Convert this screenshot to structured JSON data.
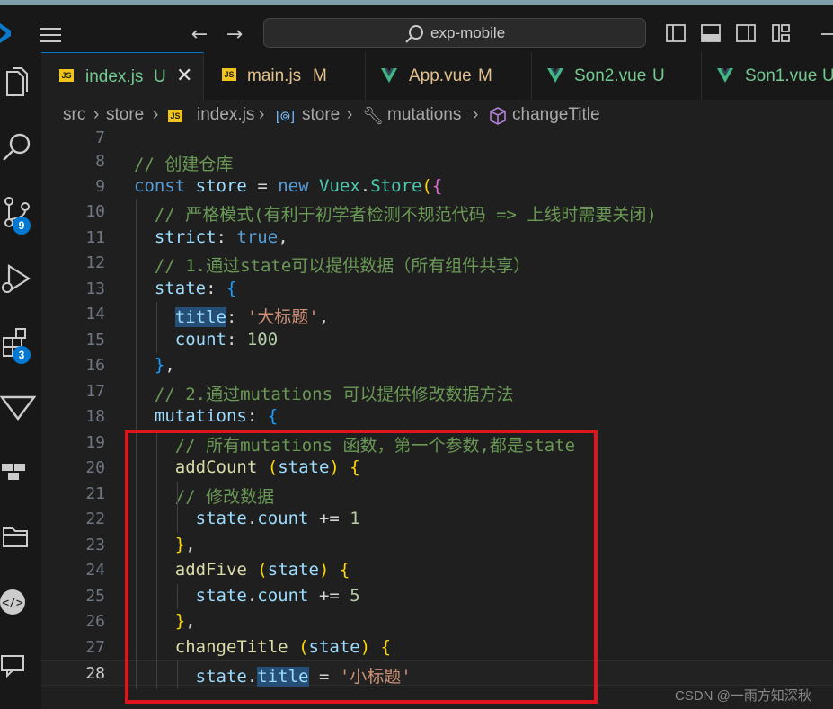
{
  "window": {
    "search_text": "exp-mobile"
  },
  "tabs": [
    {
      "name": "index.js",
      "status": "U",
      "icon": "js-icon",
      "active": true
    },
    {
      "name": "main.js",
      "status": "M",
      "icon": "js-icon",
      "active": false
    },
    {
      "name": "App.vue",
      "status": "M",
      "icon": "vue-icon",
      "active": false
    },
    {
      "name": "Son2.vue",
      "status": "U",
      "icon": "vue-icon",
      "active": false
    },
    {
      "name": "Son1.vue",
      "status": "U",
      "icon": "vue-icon",
      "active": false
    }
  ],
  "badges": {
    "source_control": "9",
    "extensions": "3"
  },
  "breadcrumb": [
    "src",
    "store",
    "index.js",
    "store",
    "mutations",
    "changeTitle"
  ],
  "editor": {
    "current_line": "28",
    "line_numbers": [
      "7",
      "8",
      "9",
      "10",
      "11",
      "12",
      "13",
      "14",
      "15",
      "16",
      "17",
      "18",
      "19",
      "20",
      "21",
      "22",
      "23",
      "24",
      "25",
      "26",
      "27",
      "28"
    ]
  },
  "code": {
    "l8_comment": "// 创建仓库",
    "l9_const": "const",
    "l9_store": "store",
    "l9_eq": "=",
    "l9_new": "new",
    "l9_vuex": "Vuex",
    "l9_storecls": "Store",
    "l10_comment": "// 严格模式(有利于初学者检测不规范代码 => 上线时需要关闭)",
    "l11_key": "strict",
    "l11_val": "true",
    "l12_comment": "// 1.通过state可以提供数据（所有组件共享）",
    "l13_key": "state",
    "l14_key": "title",
    "l14_val": "'大标题'",
    "l15_key": "count",
    "l15_val": "100",
    "l17_comment": "// 2.通过mutations 可以提供修改数据方法",
    "l18_key": "mutations",
    "l19_comment": "// 所有mutations 函数，第一个参数,都是state",
    "l20_fn": "addCount",
    "l20_param": "state",
    "l21_comment": "// 修改数据",
    "l22_obj": "state",
    "l22_prop": "count",
    "l22_op": "+=",
    "l22_val": "1",
    "l24_fn": "addFive",
    "l24_param": "state",
    "l25_obj": "state",
    "l25_prop": "count",
    "l25_op": "+=",
    "l25_val": "5",
    "l27_fn": "changeTitle",
    "l27_param": "state",
    "l28_obj": "state",
    "l28_prop": "title",
    "l28_eq": "=",
    "l28_val": "'小标题'"
  },
  "watermark": "CSDN @一雨方知深秋",
  "colors": {
    "accent": "#0078d4",
    "highlight_box": "#e0141c",
    "untracked": "#73c991",
    "modified": "#e2c08d",
    "comment": "#6a9955"
  }
}
